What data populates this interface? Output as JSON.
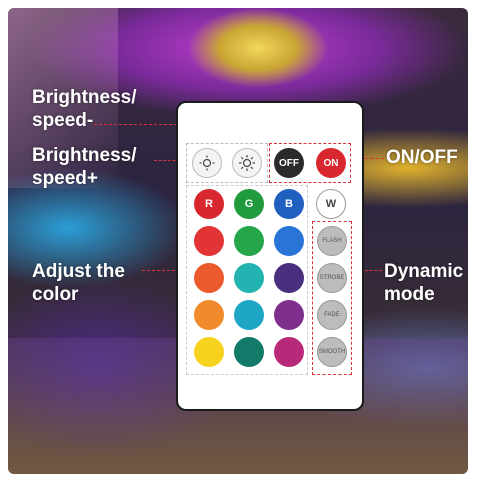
{
  "labels": {
    "brightness_down": "Brightness/ speed-",
    "brightness_up": "Brightness/ speed+",
    "on_off": "ON/OFF",
    "adjust_color": "Adjust the color",
    "dynamic_mode": "Dynamic mode"
  },
  "remote": {
    "off_label": "OFF",
    "on_label": "ON",
    "rgbw": [
      {
        "label": "R",
        "color": "#d8272e"
      },
      {
        "label": "G",
        "color": "#1f9a3c"
      },
      {
        "label": "B",
        "color": "#1e5fbf"
      },
      {
        "label": "W",
        "color": "#ffffff"
      }
    ],
    "color_grid": [
      [
        "#e23434",
        "#26a64a",
        "#2a74d8"
      ],
      [
        "#ea5a2c",
        "#22b2b0",
        "#4a2f7e"
      ],
      [
        "#f08a2a",
        "#1fa6c6",
        "#7e2f8e"
      ],
      [
        "#f6d21e",
        "#137a6a",
        "#b8297a"
      ]
    ],
    "modes": [
      "FLASH",
      "STROBE",
      "FADE",
      "SMOOTH"
    ]
  },
  "colors": {
    "accent_dash": "#d8313a",
    "power_off": "#2a2a2a",
    "power_on": "#d8272e"
  }
}
